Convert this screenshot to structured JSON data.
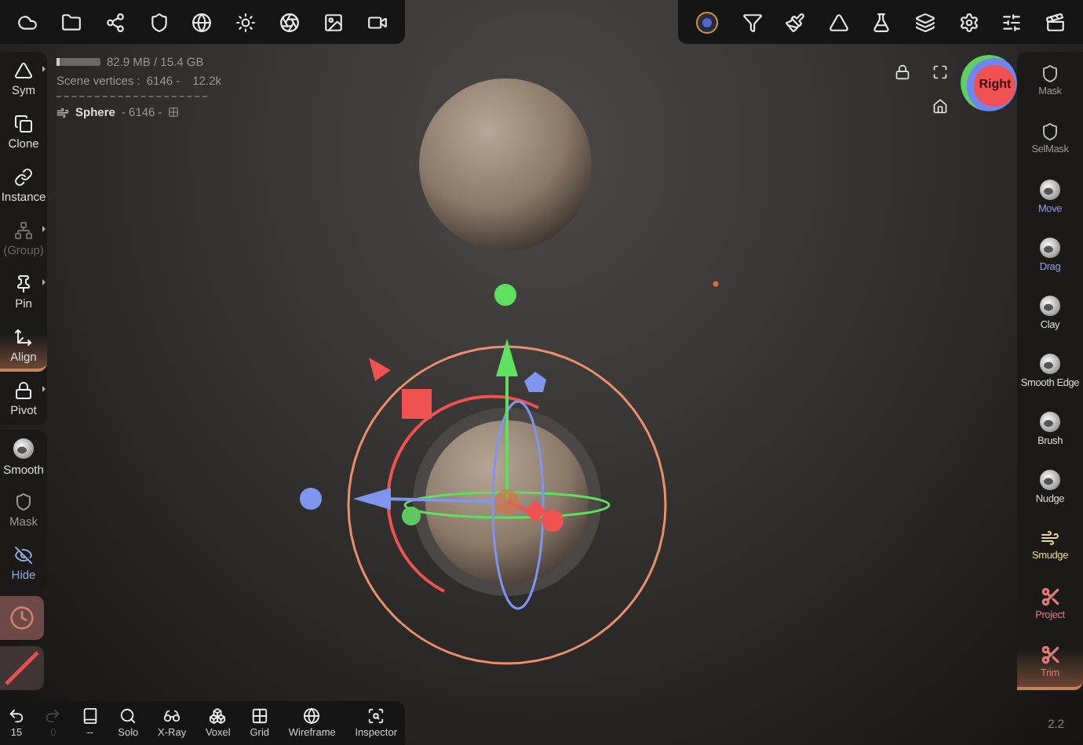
{
  "stats": {
    "memory": {
      "level": 0.06,
      "reading": "82.9 MB / 15.4 GB"
    },
    "vertices_label": "Scene vertices :",
    "vertices": "6146 -",
    "faces": "12.2k"
  },
  "object": {
    "name": "Sphere",
    "detail": "- 6146 -"
  },
  "left_tools": [
    {
      "label": "Sym",
      "selected": false,
      "disabled": false,
      "submenu": true
    },
    {
      "label": "Clone",
      "selected": false,
      "disabled": false,
      "submenu": false
    },
    {
      "label": "Instance",
      "selected": false,
      "disabled": false,
      "submenu": false
    },
    {
      "label": "(Group)",
      "selected": false,
      "disabled": true,
      "submenu": true
    },
    {
      "label": "Pin",
      "selected": false,
      "disabled": false,
      "submenu": true
    },
    {
      "label": "Align",
      "selected": true,
      "disabled": false,
      "submenu": false
    },
    {
      "label": "Pivot",
      "selected": false,
      "disabled": false,
      "submenu": true
    }
  ],
  "left_brushes": [
    {
      "label": "Smooth",
      "color": "#dddddd"
    },
    {
      "label": "Mask",
      "color": "#9a9a9a"
    },
    {
      "label": "Hide",
      "color": "#8fa8e0"
    }
  ],
  "right_tools": [
    {
      "label": "Mask",
      "selected": false,
      "color": "#9a9a9a"
    },
    {
      "label": "SelMask",
      "selected": false,
      "color": "#9a9a9a"
    },
    {
      "label": "Move",
      "selected": false,
      "color": "#8f9be0"
    },
    {
      "label": "Drag",
      "selected": false,
      "color": "#8f9be0"
    },
    {
      "label": "Clay",
      "selected": false,
      "color": "#dddddd"
    },
    {
      "label": "Smooth Edge",
      "selected": false,
      "color": "#dddddd"
    },
    {
      "label": "Brush",
      "selected": false,
      "color": "#dddddd"
    },
    {
      "label": "Nudge",
      "selected": false,
      "color": "#dddddd"
    },
    {
      "label": "Smudge",
      "selected": false,
      "color": "#e8d890"
    },
    {
      "label": "Project",
      "selected": false,
      "color": "#e07a7a"
    },
    {
      "label": "Trim",
      "selected": true,
      "color": "#e07a7a"
    }
  ],
  "nav": {
    "face": "Right"
  },
  "bottom_tools": [
    {
      "label": "15",
      "disabled": false
    },
    {
      "label": "0",
      "disabled": true
    },
    {
      "label": "--",
      "disabled": false
    },
    {
      "label": "Solo",
      "disabled": false
    },
    {
      "label": "X-Ray",
      "disabled": false
    },
    {
      "label": "Voxel",
      "disabled": false
    },
    {
      "label": "Grid",
      "disabled": false
    },
    {
      "label": "Wireframe",
      "disabled": false
    },
    {
      "label": "Inspector",
      "disabled": false
    }
  ],
  "version": "2.2"
}
